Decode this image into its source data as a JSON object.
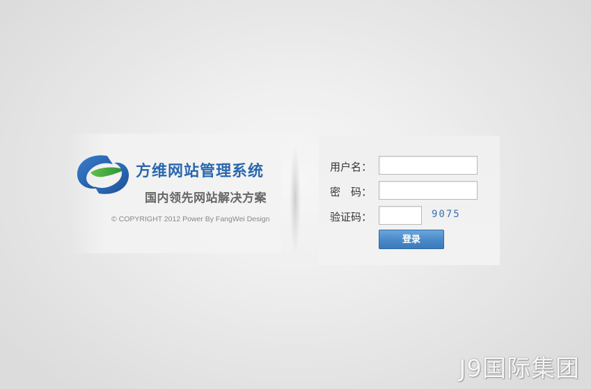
{
  "brand": {
    "title": "方维网站管理系统",
    "slogan": "国内领先网站解决方案",
    "copyright": "© COPYRIGHT 2012 Power By FangWei Design",
    "logo_icon": "fangwei-swirl-logo",
    "colors": {
      "title": "#2a67ad",
      "logo_blue": "#1f5da8",
      "logo_green": "#3aa043"
    }
  },
  "login_form": {
    "username_label": "用户名：",
    "username_value": "",
    "password_label": "密　码：",
    "password_value": "",
    "captcha_label": "验证码：",
    "captcha_value": "",
    "captcha_image_text": "9075",
    "submit_label": "登录",
    "colors": {
      "button": "#4c8bc9",
      "captcha": "#3a6fb0"
    }
  },
  "watermark": {
    "text": "J9国际集团"
  }
}
